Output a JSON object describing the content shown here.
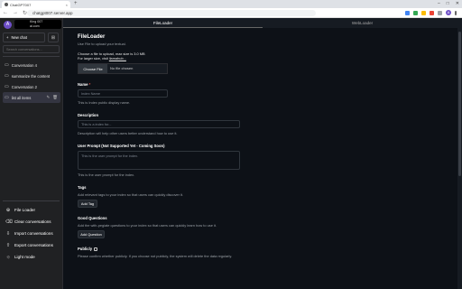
{
  "browser": {
    "tab_title": "ChatGPT007",
    "url": "chatgpt007.server.app",
    "profile_initial": "A"
  },
  "sidebar": {
    "user_initial": "A",
    "user_name": "King 007",
    "user_sub": "ai.com",
    "new_chat": "New chat",
    "search_placeholder": "Search conversations...",
    "conversations": [
      {
        "label": "Conversation 4"
      },
      {
        "label": "summarize the content"
      },
      {
        "label": "Conversation 2"
      },
      {
        "label": "list all items"
      }
    ],
    "bottom": [
      {
        "label": "File Loader",
        "icon": "file-icon"
      },
      {
        "label": "Clear conversations",
        "icon": "trash-icon"
      },
      {
        "label": "Import conversations",
        "icon": "import-icon"
      },
      {
        "label": "Export conversations",
        "icon": "export-icon"
      },
      {
        "label": "Light mode",
        "icon": "sun-icon"
      }
    ]
  },
  "main": {
    "tabs": [
      {
        "label": "FileLoader",
        "active": true
      },
      {
        "label": "WebLoader",
        "active": false
      }
    ],
    "title": "FileLoader",
    "subtitle": "Use File to upload your textual.",
    "choose_text": "Choose a file to upload, max size is 3.0 MB",
    "larger_text": "For larger size, visit",
    "larger_link": "llamahub...",
    "choose_button": "Choose File",
    "no_file": "No file chosen",
    "name_label": "Name",
    "name_placeholder": "Index Name",
    "name_help": "This is Index public display name.",
    "description_label": "Description",
    "description_placeholder": "This is a index for...",
    "description_help": "Description will help other users better understand how to use it.",
    "prompt_label": "User Prompt (Not Supported Yet - Coming Soon)",
    "prompt_placeholder": "This is the user prompt for the index.",
    "prompt_help": "This is the user prompt for the index.",
    "tags_label": "Tags",
    "tags_help": "Add relevant tags to your index so that users can quickly discover it.",
    "add_tag": "Add Tag",
    "questions_label": "Good Questions",
    "questions_help": "Add the with-pegiate questions to your index so that users can quickly learn how to use it.",
    "add_question": "Add Question",
    "public_label": "Publicly",
    "public_help": "Please confirm whether publicly. If you choose not publicly, the system will delete the data regularly."
  }
}
